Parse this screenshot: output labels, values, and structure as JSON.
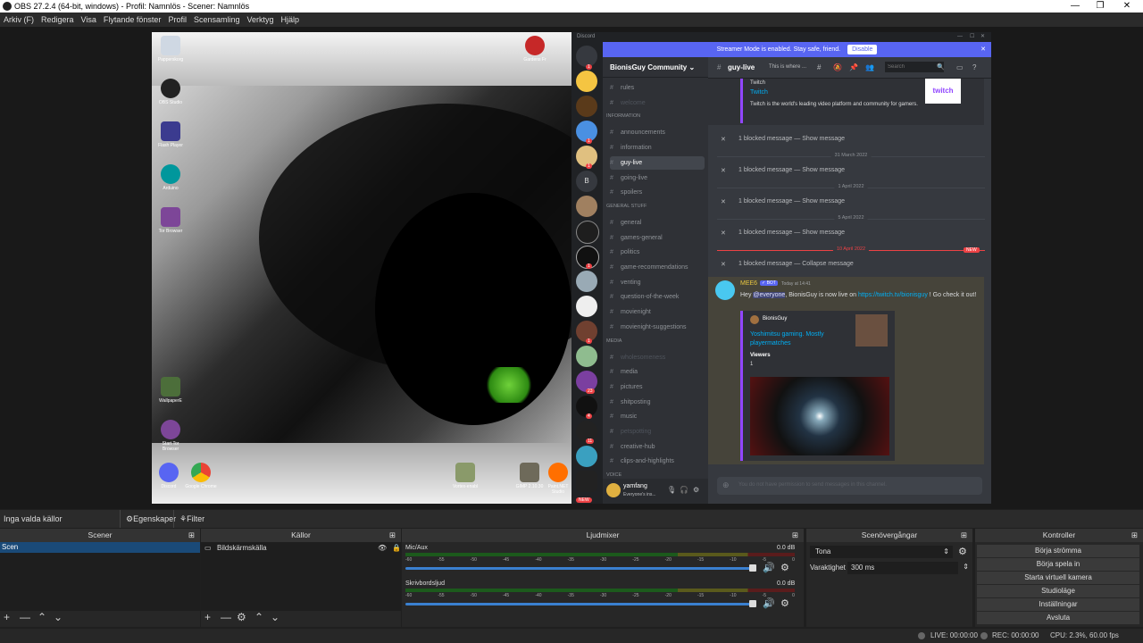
{
  "titlebar": {
    "title": "OBS 27.2.4 (64-bit, windows) - Profil: Namnlös - Scener: Namnlös",
    "minimize": "—",
    "maximize": "❐",
    "close": "✕"
  },
  "menubar": [
    "Arkiv (F)",
    "Redigera",
    "Visa",
    "Flytande fönster",
    "Profil",
    "Scensamling",
    "Verktyg",
    "Hjälp"
  ],
  "desktop_icons": {
    "recycle": "Papperskorg",
    "obs": "OBS Studio",
    "flash": "Flash Player",
    "arduino": "Arduino",
    "tor": "Tor Browser",
    "wallpaper": "WallpaperE",
    "start_tor": "Start Tor Browser",
    "discord": "Discord",
    "chrome": "Google Chrome",
    "num_app": "Gardens Fr",
    "vortex": "Vortex-enabl",
    "gimp": "GIMP 2.10.30",
    "paint": "Paint.NET Studio"
  },
  "discord": {
    "app_label": "Discord",
    "win_min": "—",
    "win_max": "☐",
    "win_close": "✕",
    "banner_text": "Streamer Mode is enabled. Stay safe, friend.",
    "banner_button": "Disable",
    "banner_close": "✕",
    "guild_badges": [
      "1",
      "1",
      "1",
      "1",
      "1",
      "23",
      "4",
      "11"
    ],
    "guild_letter": "B",
    "guild_new": "NEW",
    "server_name": "BionisGuy Community",
    "categories": {
      "information": "INFORMATION",
      "general": "GENERAL STUFF",
      "media": "MEDIA",
      "voice": "VOICE"
    },
    "channels_top": [
      {
        "name": "rules",
        "muted": false
      },
      {
        "name": "welcome",
        "muted": true
      }
    ],
    "channels_info": [
      {
        "name": "announcements",
        "muted": false
      },
      {
        "name": "information",
        "muted": false
      },
      {
        "name": "guy-live",
        "muted": false,
        "active": true
      },
      {
        "name": "going-live",
        "muted": false
      },
      {
        "name": "spoilers",
        "muted": false
      }
    ],
    "channels_general": [
      {
        "name": "general",
        "muted": false
      },
      {
        "name": "games-general",
        "muted": false
      },
      {
        "name": "politics",
        "muted": false
      },
      {
        "name": "game-recommendations",
        "muted": false
      },
      {
        "name": "venting",
        "muted": false
      },
      {
        "name": "question-of-the-week",
        "muted": false
      },
      {
        "name": "movienight",
        "muted": false
      },
      {
        "name": "movienight-suggestions",
        "muted": false
      }
    ],
    "channels_media": [
      {
        "name": "wholesomeness",
        "muted": true
      },
      {
        "name": "media",
        "muted": false
      },
      {
        "name": "pictures",
        "muted": false
      },
      {
        "name": "shitposting",
        "muted": false
      },
      {
        "name": "music",
        "muted": false
      },
      {
        "name": "petspotting",
        "muted": true
      },
      {
        "name": "creative-hub",
        "muted": false
      },
      {
        "name": "clips-and-highlights",
        "muted": false
      }
    ],
    "user": {
      "name": "yamfang",
      "status": "Everyone's ins..."
    },
    "channel_title": "guy-live",
    "channel_topic": "This is where ...",
    "search_placeholder": "Search",
    "embed_provider": "Twitch",
    "embed_title": "Twitch",
    "embed_desc": "Twitch is the world's leading video platform and community for gamers.",
    "embed_thumb": "twitch",
    "blocked_1": "1 blocked message — Show message",
    "date_1": "31 March 2022",
    "blocked_2": "1 blocked message — Show message",
    "date_2": "1 April 2022",
    "blocked_3": "1 blocked message — Show message",
    "date_3": "5 April 2022",
    "blocked_4": "1 blocked message — Show message",
    "date_4": "10 April 2022",
    "new_badge": "NEW",
    "blocked_5": "1 blocked message — Collapse message",
    "msg_author": "MEE6",
    "msg_bot": "✓ BOT",
    "msg_time": "Today at 14:41",
    "msg_hey": "Hey ",
    "msg_mention": "@everyone",
    "msg_middle": ", BionisGuy is now live on ",
    "msg_link": "https://twitch.tv/bionisguy",
    "msg_end": " ! Go check it out!",
    "embed2_author": "BionisGuy",
    "embed2_title": "Yoshimitsu gaming. Mostly playermatches",
    "embed2_field_name": "Viewers",
    "embed2_field_value": "1",
    "input_placeholder": "You do not have permission to send messages in this channel."
  },
  "props": {
    "no_source": "Inga valda källor",
    "properties": "Egenskaper",
    "filters": "Filter"
  },
  "scenes": {
    "title": "Scener",
    "items": [
      "Scen"
    ]
  },
  "sources": {
    "title": "Källor",
    "items": [
      "Bildskärmskälla"
    ]
  },
  "mixer": {
    "title": "Ljudmixer",
    "ticks": [
      "-60",
      "-55",
      "-50",
      "-45",
      "-40",
      "-35",
      "-30",
      "-25",
      "-20",
      "-15",
      "-10",
      "-5",
      "0"
    ],
    "tracks": [
      {
        "name": "Mic/Aux",
        "db": "0.0 dB",
        "level": 0.87,
        "volume": 0.9
      },
      {
        "name": "Skrivbordsljud",
        "db": "0.0 dB",
        "level": 0.84,
        "volume": 0.9
      }
    ]
  },
  "transitions": {
    "title": "Scenövergångar",
    "selected": "Tona",
    "duration_label": "Varaktighet",
    "duration": "300 ms"
  },
  "controls": {
    "title": "Kontroller",
    "buttons": [
      "Börja strömma",
      "Börja spela in",
      "Starta virtuell kamera",
      "Studioläge",
      "Inställningar",
      "Avsluta"
    ]
  },
  "status": {
    "live": "LIVE: 00:00:00",
    "rec": "REC: 00:00:00",
    "cpu": "CPU: 2.3%, 60.00 fps"
  }
}
